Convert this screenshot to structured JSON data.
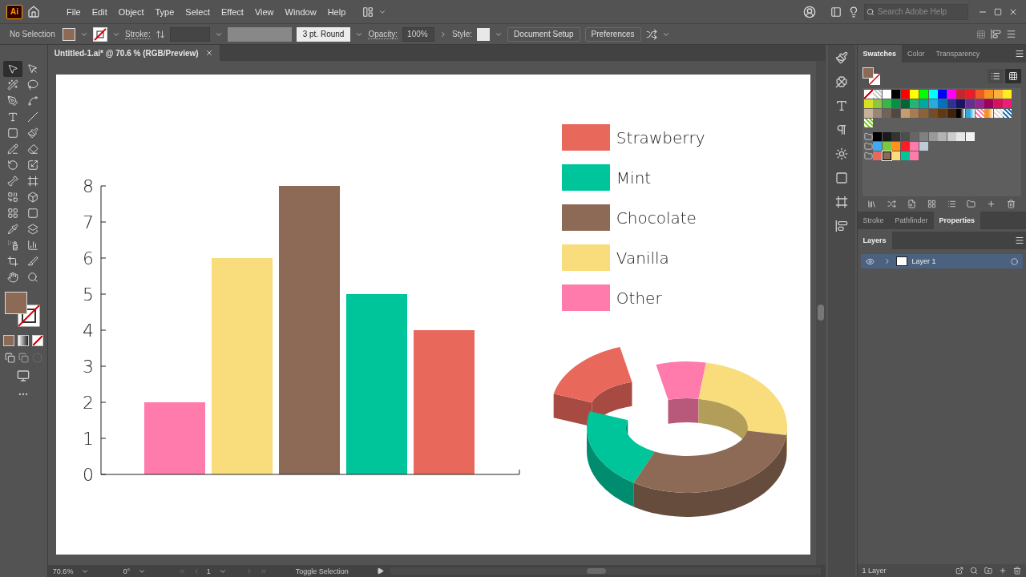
{
  "app_logo": "Ai",
  "menu": [
    "File",
    "Edit",
    "Object",
    "Type",
    "Select",
    "Effect",
    "View",
    "Window",
    "Help"
  ],
  "search": {
    "placeholder": "Search Adobe Help"
  },
  "control_bar": {
    "selection": "No Selection",
    "stroke_label": "Stroke:",
    "brush": "3 pt. Round",
    "opacity_label": "Opacity:",
    "opacity": "100%",
    "style_label": "Style:",
    "buttons": [
      "Document Setup",
      "Preferences"
    ]
  },
  "tools": [
    {
      "kind": "selection",
      "selected": true
    },
    {
      "kind": "direct-selection",
      "selected": false
    },
    {
      "kind": "magic-wand",
      "selected": false
    },
    {
      "kind": "lasso",
      "selected": false
    },
    {
      "kind": "pen",
      "selected": false
    },
    {
      "kind": "curvature",
      "selected": false
    },
    {
      "kind": "type",
      "selected": false
    },
    {
      "kind": "line",
      "selected": false
    },
    {
      "kind": "rectangle",
      "selected": false
    },
    {
      "kind": "paintbrush",
      "selected": false
    },
    {
      "kind": "shaper",
      "selected": false
    },
    {
      "kind": "eraser",
      "selected": false
    },
    {
      "kind": "rotate",
      "selected": false
    },
    {
      "kind": "scale",
      "selected": false
    },
    {
      "kind": "puppet-warp",
      "selected": false
    },
    {
      "kind": "free-transform",
      "selected": false
    },
    {
      "kind": "shape-builder",
      "selected": false
    },
    {
      "kind": "perspective-grid",
      "selected": false
    },
    {
      "kind": "mesh",
      "selected": false
    },
    {
      "kind": "gradient",
      "selected": false
    },
    {
      "kind": "eyedropper",
      "selected": false
    },
    {
      "kind": "blend",
      "selected": false
    },
    {
      "kind": "symbol-sprayer",
      "selected": false
    },
    {
      "kind": "column-graph",
      "selected": false
    },
    {
      "kind": "artboard",
      "selected": false
    },
    {
      "kind": "slice",
      "selected": false
    },
    {
      "kind": "hand",
      "selected": false
    },
    {
      "kind": "zoom",
      "selected": false
    }
  ],
  "document_tab": {
    "title": "Untitled-1.ai* @ 70.6 % (RGB/Preview)"
  },
  "artboard": {
    "bar_chart": {
      "chart_data": {
        "type": "bar",
        "values": [
          2,
          6,
          8,
          5,
          4
        ],
        "colors": [
          "#ff7bac",
          "#f9dc7c",
          "#8c6a55",
          "#00c49a",
          "#e8685c"
        ],
        "ylim": [
          0,
          8
        ],
        "yticks": [
          0,
          1,
          2,
          3,
          4,
          5,
          6,
          7,
          8
        ]
      }
    },
    "legend": [
      {
        "label": "Strawberry",
        "color": "#e8685c"
      },
      {
        "label": "Mint",
        "color": "#00c49a"
      },
      {
        "label": "Chocolate",
        "color": "#8c6a55"
      },
      {
        "label": "Vanilla",
        "color": "#f9dc7c"
      },
      {
        "label": "Other",
        "color": "#ff7bac"
      }
    ]
  },
  "panel_tabs": [
    {
      "label": "Swatches",
      "selected": true
    },
    {
      "label": "Color",
      "selected": false
    },
    {
      "label": "Transparency",
      "selected": false
    }
  ],
  "swatches": {
    "view_modes": [
      {
        "kind": "list",
        "selected": false
      },
      {
        "kind": "grid",
        "selected": true
      }
    ],
    "rows": [
      [
        {
          "kind": "none",
          "color": "#ffffff",
          "selected": false
        },
        {
          "kind": "pattern",
          "color": "#cccccc",
          "selected": false
        },
        {
          "kind": "solid",
          "color": "#ffffff",
          "selected": false
        },
        {
          "kind": "solid",
          "color": "#000000",
          "selected": false
        },
        {
          "kind": "solid",
          "color": "#ff0000",
          "selected": false
        },
        {
          "kind": "solid",
          "color": "#ffff00",
          "selected": false
        },
        {
          "kind": "solid",
          "color": "#00ff00",
          "selected": false
        },
        {
          "kind": "solid",
          "color": "#00ffff",
          "selected": false
        },
        {
          "kind": "solid",
          "color": "#0000ff",
          "selected": false
        },
        {
          "kind": "solid",
          "color": "#ff00ff",
          "selected": false
        },
        {
          "kind": "solid",
          "color": "#c1272d",
          "selected": false
        },
        {
          "kind": "solid",
          "color": "#ed1c24",
          "selected": false
        },
        {
          "kind": "solid",
          "color": "#f15a24",
          "selected": false
        },
        {
          "kind": "solid",
          "color": "#f7931e",
          "selected": false
        },
        {
          "kind": "solid",
          "color": "#fbb03b",
          "selected": false
        },
        {
          "kind": "solid",
          "color": "#fcee21",
          "selected": false
        }
      ],
      [
        {
          "kind": "solid",
          "color": "#d9e021",
          "selected": false
        },
        {
          "kind": "solid",
          "color": "#8cc63f",
          "selected": false
        },
        {
          "kind": "solid",
          "color": "#39b54a",
          "selected": false
        },
        {
          "kind": "solid",
          "color": "#009245",
          "selected": false
        },
        {
          "kind": "solid",
          "color": "#006837",
          "selected": false
        },
        {
          "kind": "solid",
          "color": "#22b573",
          "selected": false
        },
        {
          "kind": "solid",
          "color": "#00a99d",
          "selected": false
        },
        {
          "kind": "solid",
          "color": "#29abe2",
          "selected": false
        },
        {
          "kind": "solid",
          "color": "#0071bc",
          "selected": false
        },
        {
          "kind": "solid",
          "color": "#2e3192",
          "selected": false
        },
        {
          "kind": "solid",
          "color": "#1b1464",
          "selected": false
        },
        {
          "kind": "solid",
          "color": "#662d91",
          "selected": false
        },
        {
          "kind": "solid",
          "color": "#93278f",
          "selected": false
        },
        {
          "kind": "solid",
          "color": "#9e005d",
          "selected": false
        },
        {
          "kind": "solid",
          "color": "#d4145a",
          "selected": false
        },
        {
          "kind": "solid",
          "color": "#ed1e79",
          "selected": false
        }
      ],
      [
        {
          "kind": "solid",
          "color": "#c7b299",
          "selected": false
        },
        {
          "kind": "solid",
          "color": "#998675",
          "selected": false
        },
        {
          "kind": "solid",
          "color": "#736357",
          "selected": false
        },
        {
          "kind": "solid",
          "color": "#534741",
          "selected": false
        },
        {
          "kind": "solid",
          "color": "#c69c6d",
          "selected": false
        },
        {
          "kind": "solid",
          "color": "#a67c52",
          "selected": false
        },
        {
          "kind": "solid",
          "color": "#8c6239",
          "selected": false
        },
        {
          "kind": "solid",
          "color": "#754c24",
          "selected": false
        },
        {
          "kind": "solid",
          "color": "#603813",
          "selected": false
        },
        {
          "kind": "solid",
          "color": "#42210b",
          "selected": false
        },
        {
          "kind": "gradient",
          "color": "#000000",
          "selected": false
        },
        {
          "kind": "gradient",
          "color": "#29abe2",
          "selected": false
        },
        {
          "kind": "pattern",
          "color": "#ff7bac",
          "selected": false
        },
        {
          "kind": "gradient",
          "color": "#f7931e",
          "selected": false
        },
        {
          "kind": "pattern",
          "color": "#dddddd",
          "selected": false
        },
        {
          "kind": "pattern",
          "color": "#1b75bc",
          "selected": false
        }
      ],
      [
        {
          "kind": "pattern",
          "color": "#8cc63f",
          "selected": false
        }
      ]
    ],
    "groups": [
      [
        {
          "kind": "solid",
          "color": "#000000",
          "selected": false
        },
        {
          "kind": "solid",
          "color": "#1a1a1a",
          "selected": false
        },
        {
          "kind": "solid",
          "color": "#333333",
          "selected": false
        },
        {
          "kind": "solid",
          "color": "#4d4d4d",
          "selected": false
        },
        {
          "kind": "solid",
          "color": "#666666",
          "selected": false
        },
        {
          "kind": "solid",
          "color": "#808080",
          "selected": false
        },
        {
          "kind": "solid",
          "color": "#999999",
          "selected": false
        },
        {
          "kind": "solid",
          "color": "#b3b3b3",
          "selected": false
        },
        {
          "kind": "solid",
          "color": "#cccccc",
          "selected": false
        },
        {
          "kind": "solid",
          "color": "#e6e6e6",
          "selected": false
        },
        {
          "kind": "solid",
          "color": "#f2f2f2",
          "selected": false
        }
      ],
      [
        {
          "kind": "solid",
          "color": "#3fa9f5",
          "selected": false
        },
        {
          "kind": "solid",
          "color": "#7ac943",
          "selected": false
        },
        {
          "kind": "solid",
          "color": "#ff931e",
          "selected": false
        },
        {
          "kind": "solid",
          "color": "#ff1d25",
          "selected": false
        },
        {
          "kind": "solid",
          "color": "#ff7bac",
          "selected": false
        },
        {
          "kind": "solid",
          "color": "#bdccd4",
          "selected": false
        }
      ],
      [
        {
          "kind": "solid",
          "color": "#e8685c",
          "selected": false
        },
        {
          "kind": "solid",
          "color": "#8c6a55",
          "selected": true
        },
        {
          "kind": "solid",
          "color": "#f9dc7c",
          "selected": false
        },
        {
          "kind": "solid",
          "color": "#00c49a",
          "selected": false
        },
        {
          "kind": "solid",
          "color": "#ff7bac",
          "selected": false
        }
      ]
    ]
  },
  "lower_tabs": [
    {
      "label": "Stroke",
      "selected": false
    },
    {
      "label": "Pathfinder",
      "selected": false
    },
    {
      "label": "Properties",
      "selected": true
    }
  ],
  "layers": {
    "tab": "Layers",
    "items": [
      {
        "name": "Layer 1",
        "visible": true,
        "selected": true
      }
    ],
    "count": "1 Layer"
  },
  "status_bar": {
    "zoom": "70.6%",
    "rotation": "0°",
    "artboard": "1",
    "message": "Toggle Selection"
  }
}
